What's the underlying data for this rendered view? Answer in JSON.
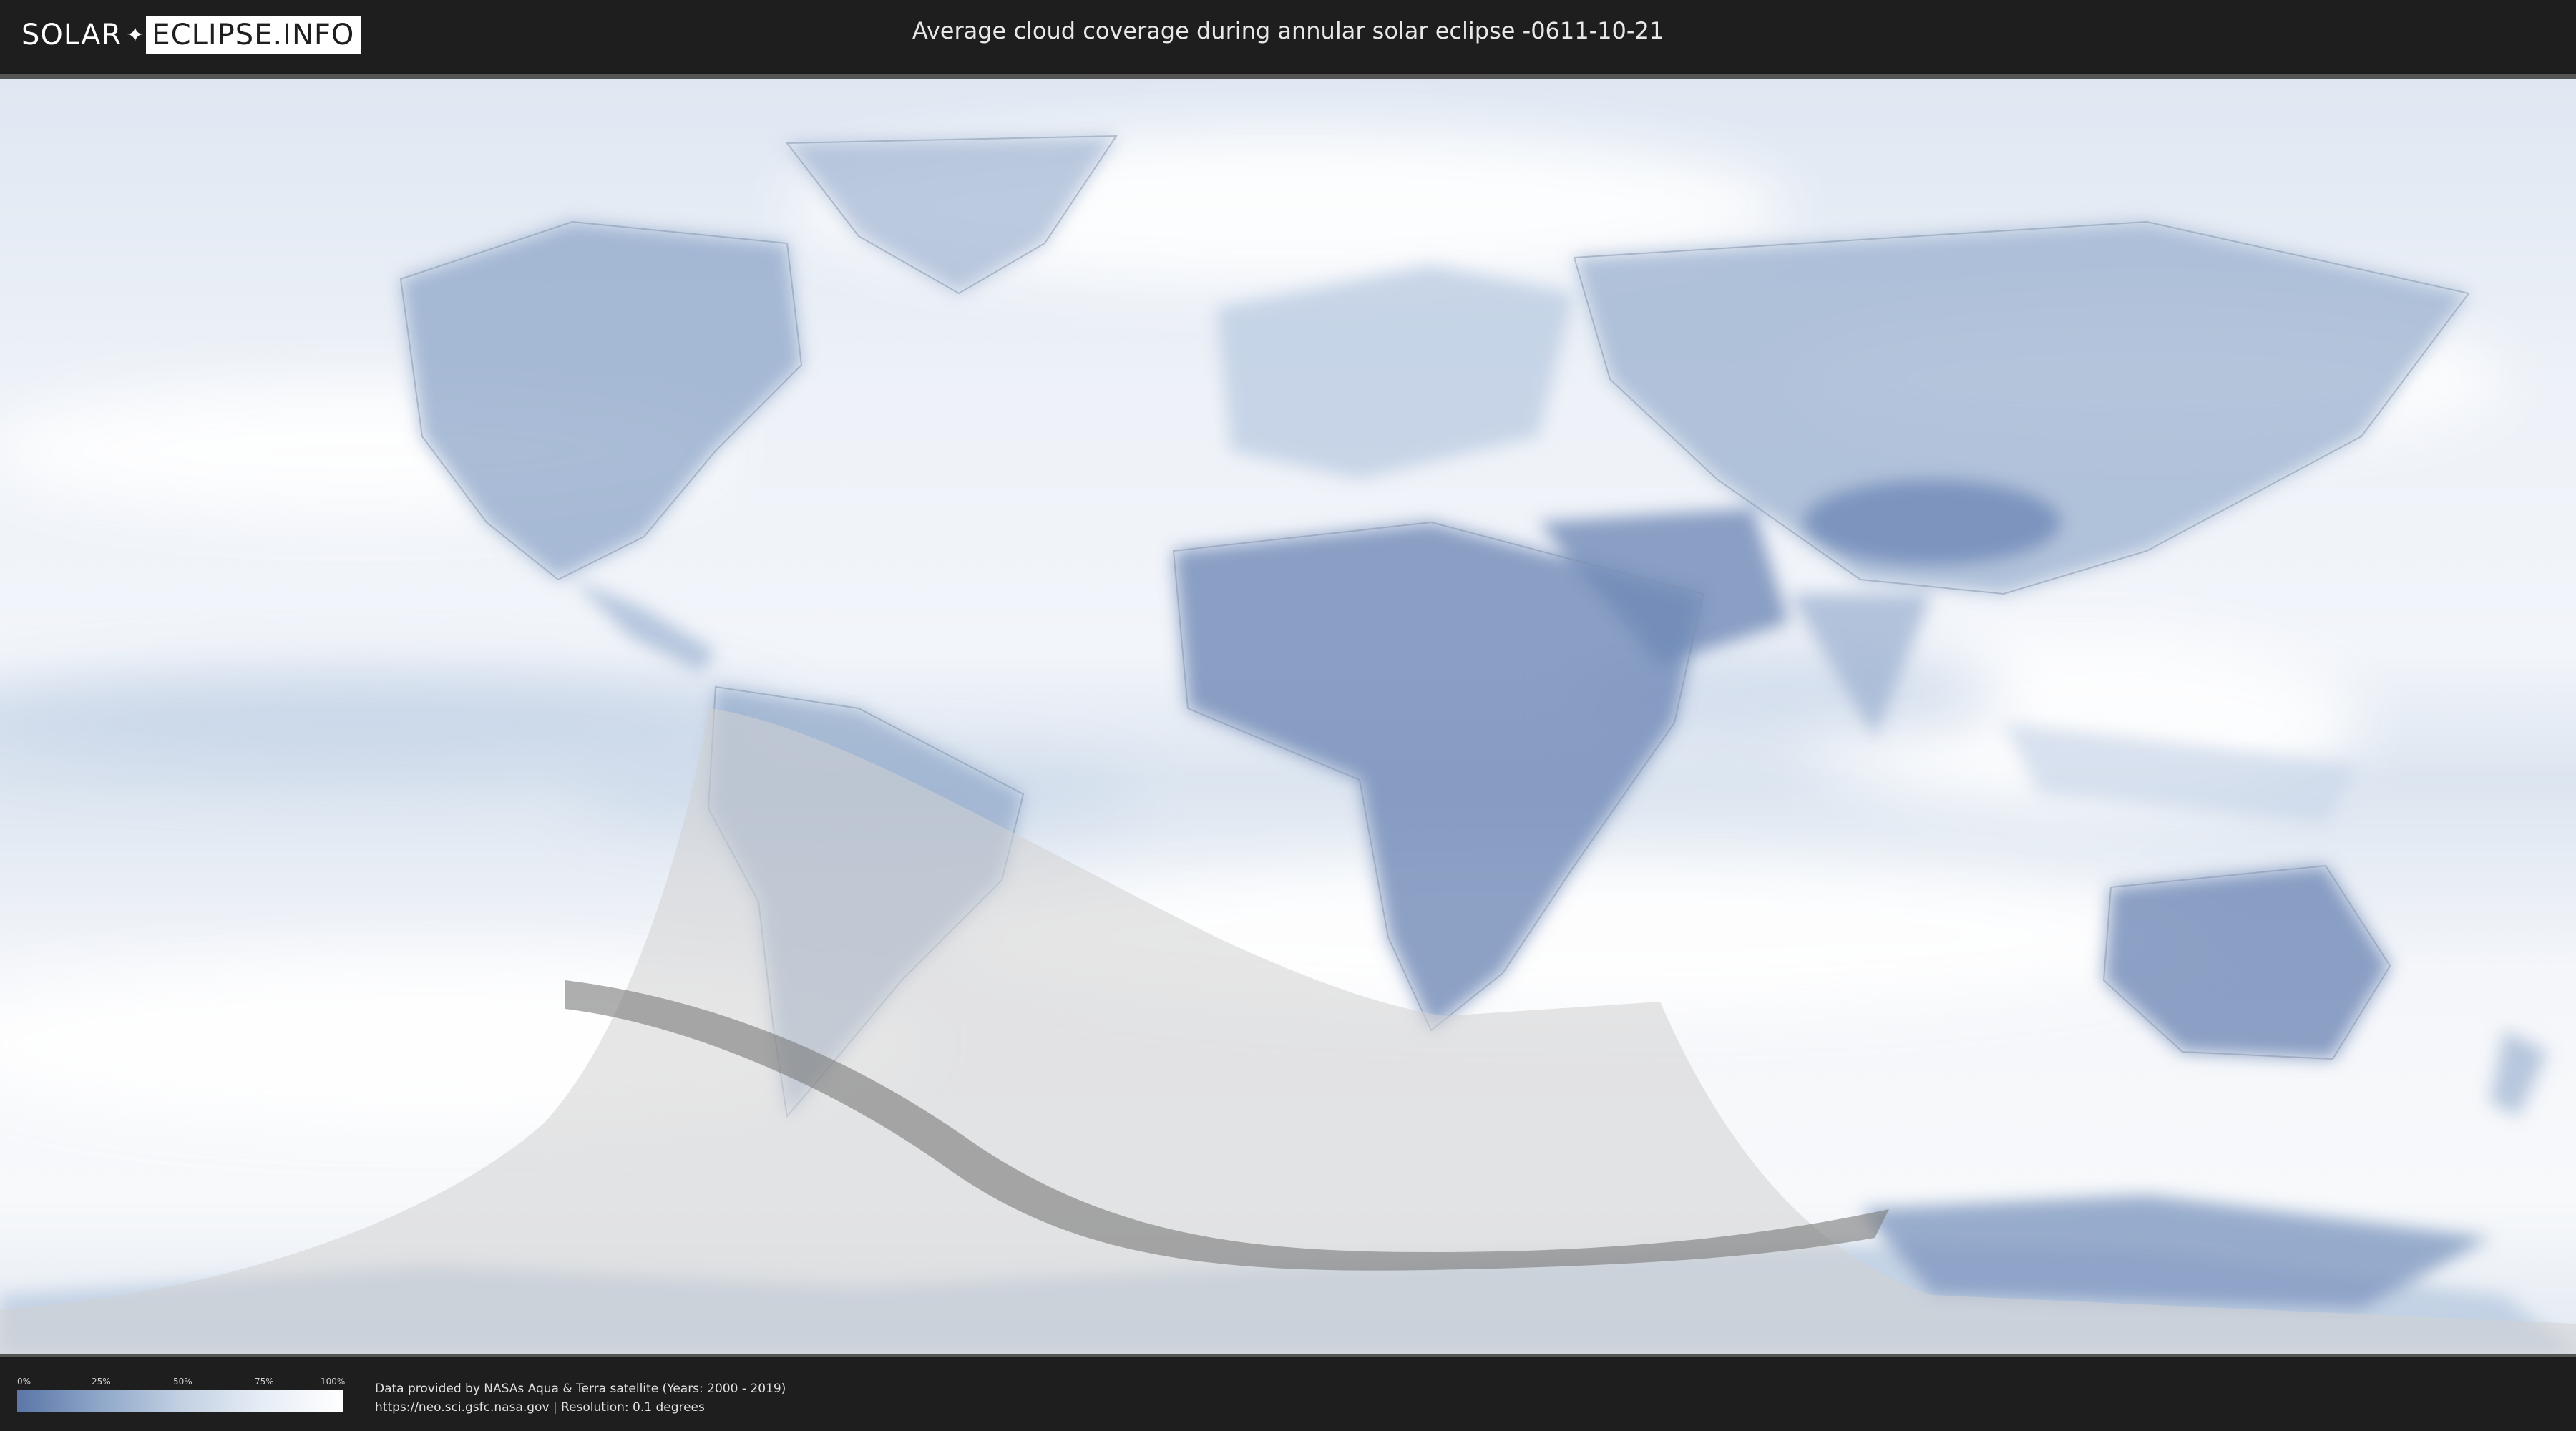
{
  "header": {
    "logo_part1": "SOLAR",
    "logo_part2": "ECLIPSE.INFO",
    "title": "Average cloud coverage during annular solar eclipse -0611-10-21"
  },
  "legend": {
    "ticks": [
      "0%",
      "25%",
      "50%",
      "75%",
      "100%"
    ],
    "scale": "cloud coverage 0% (blue) to 100% (white)"
  },
  "footer": {
    "credit_line1": "Data provided by NASAs Aqua & Terra satellite (Years: 2000 - 2019)",
    "credit_line2": "https://neo.sci.gsfc.nasa.gov | Resolution: 0.1 degrees"
  },
  "colors": {
    "clear_sky": "#5b76a8",
    "cloud": "#ffffff",
    "penumbra": "#d6d6d6",
    "annular_path": "#7a7a7a"
  }
}
